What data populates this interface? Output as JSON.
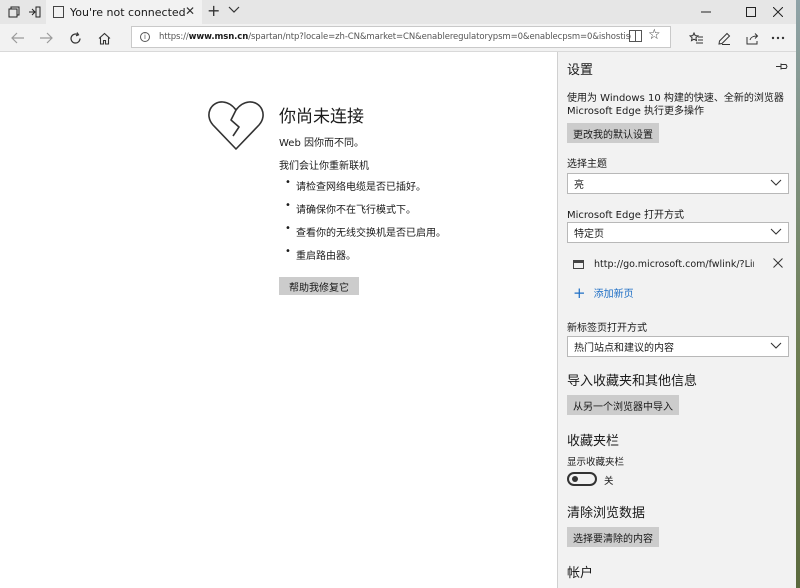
{
  "window": {
    "tab_title": "You're not connected",
    "new_tab_glyph": "+",
    "tab_close_glyph": "✕"
  },
  "address": {
    "url_prefix": "https://",
    "url_host": "www.msn.cn",
    "url_rest": "/spartan/ntp?locale=zh-CN&market=CN&enableregulatorypsm=0&enablecpsm=0&ishostisolationenforc"
  },
  "error": {
    "title": "你尚未连接",
    "subtitle": "Web 因你而不同。",
    "line": "我们会让你重新联机",
    "tips": [
      "请检查网络电缆是否已插好。",
      "请确保你不在飞行模式下。",
      "查看你的无线交换机是否已启用。",
      "重启路由器。"
    ],
    "fix_button": "帮助我修复它"
  },
  "settings": {
    "title": "设置",
    "description": "使用为 Windows 10 构建的快速、全新的浏览器 Microsoft Edge 执行更多操作",
    "default_button": "更改我的默认设置",
    "theme_label": "选择主题",
    "theme_value": "亮",
    "open_with_label": "Microsoft Edge 打开方式",
    "open_with_value": "特定页",
    "page_url": "http://go.microsoft.com/fwlink/?LinkId=",
    "add_page": "添加新页",
    "new_tab_label": "新标签页打开方式",
    "new_tab_value": "热门站点和建议的内容",
    "import_heading": "导入收藏夹和其他信息",
    "import_button": "从另一个浏览器中导入",
    "favbar_heading": "收藏夹栏",
    "favbar_label": "显示收藏夹栏",
    "favbar_toggle": "关",
    "clear_heading": "清除浏览数据",
    "clear_button": "选择要清除的内容",
    "account_heading": "帐户"
  },
  "icons": {
    "tab_close": "close-icon",
    "pin": "pin-icon",
    "url_close": "close-icon",
    "dropdown": "chevron-down-icon"
  }
}
